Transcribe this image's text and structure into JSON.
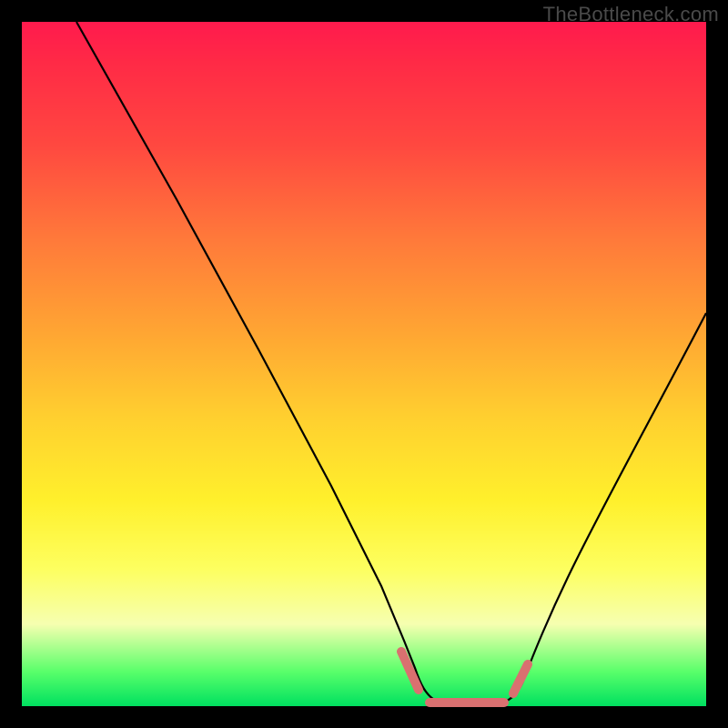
{
  "watermark": "TheBottleneck.com",
  "colors": {
    "curve_stroke": "#000000",
    "marker_stroke": "#d97070",
    "frame_bg": "#000000"
  },
  "chart_data": {
    "type": "line",
    "title": "",
    "xlabel": "",
    "ylabel": "",
    "xlim": [
      0,
      100
    ],
    "ylim": [
      0,
      100
    ],
    "series": [
      {
        "name": "bottleneck-curve",
        "x": [
          8,
          15,
          22,
          30,
          38,
          45,
          52,
          55,
          57,
          60,
          63,
          65,
          68,
          70,
          72,
          76,
          80,
          84,
          88,
          92,
          96,
          100
        ],
        "y": [
          100,
          85,
          71,
          56,
          42,
          29,
          14,
          7,
          3,
          0.5,
          0,
          0,
          0,
          0.5,
          3,
          10,
          18,
          26,
          34,
          42,
          50,
          58
        ]
      }
    ],
    "markers": [
      {
        "name": "trough-left-shoulder",
        "x_range": [
          53,
          57
        ],
        "y": 5
      },
      {
        "name": "trough-flat",
        "x_range": [
          57,
          69
        ],
        "y": 0.5
      },
      {
        "name": "trough-right-shoulder",
        "x_range": [
          69,
          73
        ],
        "y": 5
      }
    ],
    "annotations": []
  }
}
